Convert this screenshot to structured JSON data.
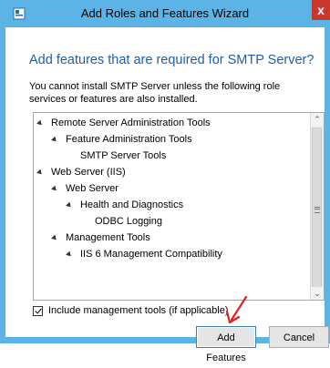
{
  "window": {
    "title": "Add Roles and Features Wizard",
    "close_label": "x"
  },
  "dialog": {
    "heading": "Add features that are required for SMTP Server?",
    "description": "You cannot install SMTP Server unless the following role services or features are also installed."
  },
  "tree": {
    "items": [
      {
        "label": "Remote Server Administration Tools",
        "expanded": true
      },
      {
        "label": "Feature Administration Tools",
        "expanded": true
      },
      {
        "label": "SMTP Server Tools",
        "expanded": false
      },
      {
        "label": "Web Server (IIS)",
        "expanded": true
      },
      {
        "label": "Web Server",
        "expanded": true
      },
      {
        "label": "Health and Diagnostics",
        "expanded": true
      },
      {
        "label": "ODBC Logging",
        "expanded": false
      },
      {
        "label": "Management Tools",
        "expanded": true
      },
      {
        "label": "IIS 6 Management Compatibility",
        "expanded": true
      }
    ]
  },
  "options": {
    "include_tools_label": "Include management tools (if applicable)",
    "include_tools_checked": true
  },
  "buttons": {
    "add_features": "Add Features",
    "cancel": "Cancel"
  },
  "colors": {
    "title_bar": "#5bb3e6",
    "heading": "#1e5faa",
    "close_button": "#c8382c",
    "annotation_arrow": "#e02020"
  }
}
